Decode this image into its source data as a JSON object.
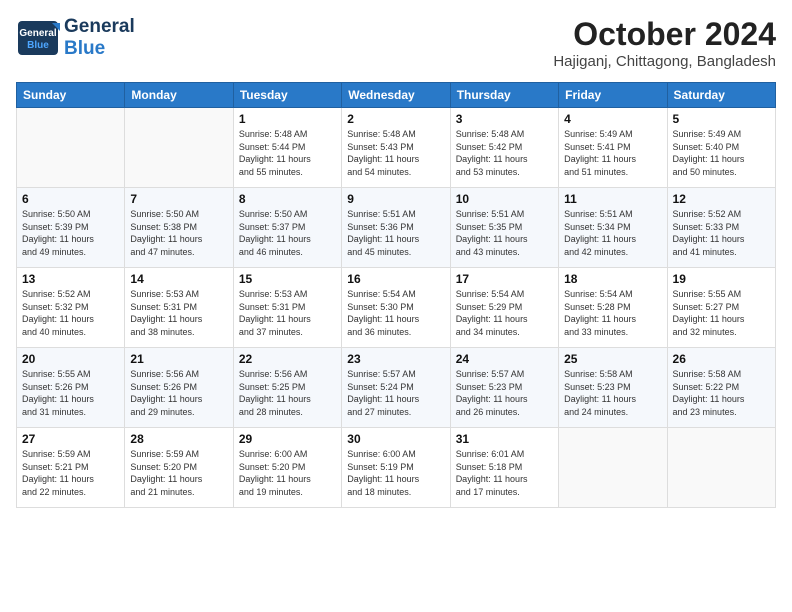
{
  "header": {
    "logo_general": "General",
    "logo_blue": "Blue",
    "month_title": "October 2024",
    "location": "Hajiganj, Chittagong, Bangladesh"
  },
  "weekdays": [
    "Sunday",
    "Monday",
    "Tuesday",
    "Wednesday",
    "Thursday",
    "Friday",
    "Saturday"
  ],
  "weeks": [
    [
      {
        "day": "",
        "info": ""
      },
      {
        "day": "",
        "info": ""
      },
      {
        "day": "1",
        "info": "Sunrise: 5:48 AM\nSunset: 5:44 PM\nDaylight: 11 hours\nand 55 minutes."
      },
      {
        "day": "2",
        "info": "Sunrise: 5:48 AM\nSunset: 5:43 PM\nDaylight: 11 hours\nand 54 minutes."
      },
      {
        "day": "3",
        "info": "Sunrise: 5:48 AM\nSunset: 5:42 PM\nDaylight: 11 hours\nand 53 minutes."
      },
      {
        "day": "4",
        "info": "Sunrise: 5:49 AM\nSunset: 5:41 PM\nDaylight: 11 hours\nand 51 minutes."
      },
      {
        "day": "5",
        "info": "Sunrise: 5:49 AM\nSunset: 5:40 PM\nDaylight: 11 hours\nand 50 minutes."
      }
    ],
    [
      {
        "day": "6",
        "info": "Sunrise: 5:50 AM\nSunset: 5:39 PM\nDaylight: 11 hours\nand 49 minutes."
      },
      {
        "day": "7",
        "info": "Sunrise: 5:50 AM\nSunset: 5:38 PM\nDaylight: 11 hours\nand 47 minutes."
      },
      {
        "day": "8",
        "info": "Sunrise: 5:50 AM\nSunset: 5:37 PM\nDaylight: 11 hours\nand 46 minutes."
      },
      {
        "day": "9",
        "info": "Sunrise: 5:51 AM\nSunset: 5:36 PM\nDaylight: 11 hours\nand 45 minutes."
      },
      {
        "day": "10",
        "info": "Sunrise: 5:51 AM\nSunset: 5:35 PM\nDaylight: 11 hours\nand 43 minutes."
      },
      {
        "day": "11",
        "info": "Sunrise: 5:51 AM\nSunset: 5:34 PM\nDaylight: 11 hours\nand 42 minutes."
      },
      {
        "day": "12",
        "info": "Sunrise: 5:52 AM\nSunset: 5:33 PM\nDaylight: 11 hours\nand 41 minutes."
      }
    ],
    [
      {
        "day": "13",
        "info": "Sunrise: 5:52 AM\nSunset: 5:32 PM\nDaylight: 11 hours\nand 40 minutes."
      },
      {
        "day": "14",
        "info": "Sunrise: 5:53 AM\nSunset: 5:31 PM\nDaylight: 11 hours\nand 38 minutes."
      },
      {
        "day": "15",
        "info": "Sunrise: 5:53 AM\nSunset: 5:31 PM\nDaylight: 11 hours\nand 37 minutes."
      },
      {
        "day": "16",
        "info": "Sunrise: 5:54 AM\nSunset: 5:30 PM\nDaylight: 11 hours\nand 36 minutes."
      },
      {
        "day": "17",
        "info": "Sunrise: 5:54 AM\nSunset: 5:29 PM\nDaylight: 11 hours\nand 34 minutes."
      },
      {
        "day": "18",
        "info": "Sunrise: 5:54 AM\nSunset: 5:28 PM\nDaylight: 11 hours\nand 33 minutes."
      },
      {
        "day": "19",
        "info": "Sunrise: 5:55 AM\nSunset: 5:27 PM\nDaylight: 11 hours\nand 32 minutes."
      }
    ],
    [
      {
        "day": "20",
        "info": "Sunrise: 5:55 AM\nSunset: 5:26 PM\nDaylight: 11 hours\nand 31 minutes."
      },
      {
        "day": "21",
        "info": "Sunrise: 5:56 AM\nSunset: 5:26 PM\nDaylight: 11 hours\nand 29 minutes."
      },
      {
        "day": "22",
        "info": "Sunrise: 5:56 AM\nSunset: 5:25 PM\nDaylight: 11 hours\nand 28 minutes."
      },
      {
        "day": "23",
        "info": "Sunrise: 5:57 AM\nSunset: 5:24 PM\nDaylight: 11 hours\nand 27 minutes."
      },
      {
        "day": "24",
        "info": "Sunrise: 5:57 AM\nSunset: 5:23 PM\nDaylight: 11 hours\nand 26 minutes."
      },
      {
        "day": "25",
        "info": "Sunrise: 5:58 AM\nSunset: 5:23 PM\nDaylight: 11 hours\nand 24 minutes."
      },
      {
        "day": "26",
        "info": "Sunrise: 5:58 AM\nSunset: 5:22 PM\nDaylight: 11 hours\nand 23 minutes."
      }
    ],
    [
      {
        "day": "27",
        "info": "Sunrise: 5:59 AM\nSunset: 5:21 PM\nDaylight: 11 hours\nand 22 minutes."
      },
      {
        "day": "28",
        "info": "Sunrise: 5:59 AM\nSunset: 5:20 PM\nDaylight: 11 hours\nand 21 minutes."
      },
      {
        "day": "29",
        "info": "Sunrise: 6:00 AM\nSunset: 5:20 PM\nDaylight: 11 hours\nand 19 minutes."
      },
      {
        "day": "30",
        "info": "Sunrise: 6:00 AM\nSunset: 5:19 PM\nDaylight: 11 hours\nand 18 minutes."
      },
      {
        "day": "31",
        "info": "Sunrise: 6:01 AM\nSunset: 5:18 PM\nDaylight: 11 hours\nand 17 minutes."
      },
      {
        "day": "",
        "info": ""
      },
      {
        "day": "",
        "info": ""
      }
    ]
  ]
}
